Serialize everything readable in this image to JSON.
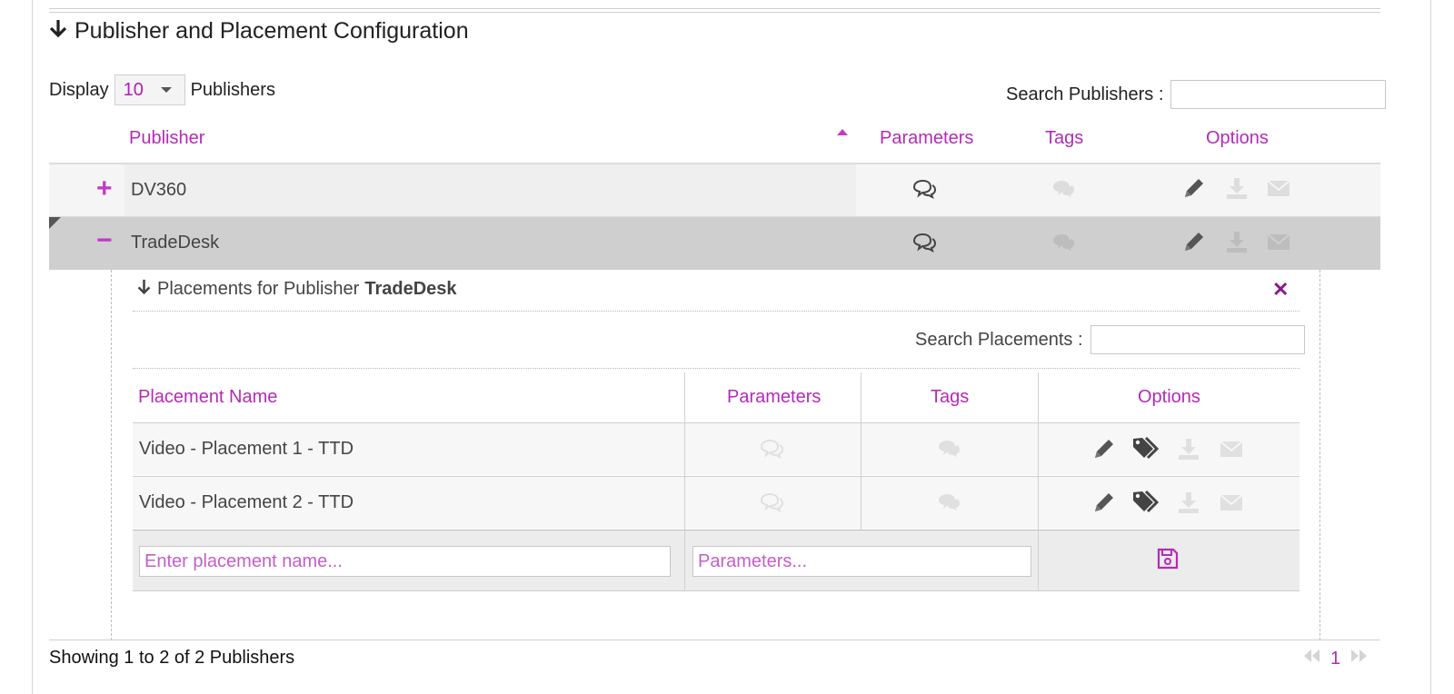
{
  "section": {
    "title": "Publisher and Placement Configuration"
  },
  "display": {
    "prefix": "Display",
    "value": "10",
    "suffix": "Publishers"
  },
  "search_publishers": {
    "label": "Search Publishers :",
    "value": ""
  },
  "publisher_table": {
    "columns": [
      "Publisher",
      "Parameters",
      "Tags",
      "Options"
    ],
    "rows": [
      {
        "toggle": "+",
        "name": "DV360",
        "expanded": false
      },
      {
        "toggle": "−",
        "name": "TradeDesk",
        "expanded": true
      }
    ]
  },
  "placements": {
    "title_prefix": "Placements for Publisher",
    "publisher": "TradeDesk",
    "close": "✕",
    "search_label": "Search Placements :",
    "search_value": "",
    "columns": [
      "Placement Name",
      "Parameters",
      "Tags",
      "Options"
    ],
    "rows": [
      {
        "name": "Video - Placement 1 - TTD"
      },
      {
        "name": "Video - Placement 2 - TTD"
      }
    ],
    "new_name_placeholder": "Enter placement name...",
    "new_params_placeholder": "Parameters..."
  },
  "footer": {
    "showing": "Showing 1 to 2 of 2 Publishers",
    "page": "1"
  },
  "colors": {
    "accent": "#b42ab8",
    "close": "#8a1a8a",
    "icon_active": "#555555",
    "icon_disabled": "#dddddd"
  },
  "icons": [
    "arrow-down-icon",
    "caret-down-icon",
    "sort-up-icon",
    "plus-icon",
    "minus-icon",
    "comments-icon",
    "tags-comment-icon",
    "pencil-icon",
    "download-icon",
    "envelope-icon",
    "tag-icon",
    "save-icon",
    "close-icon",
    "first-page-icon",
    "last-page-icon"
  ]
}
